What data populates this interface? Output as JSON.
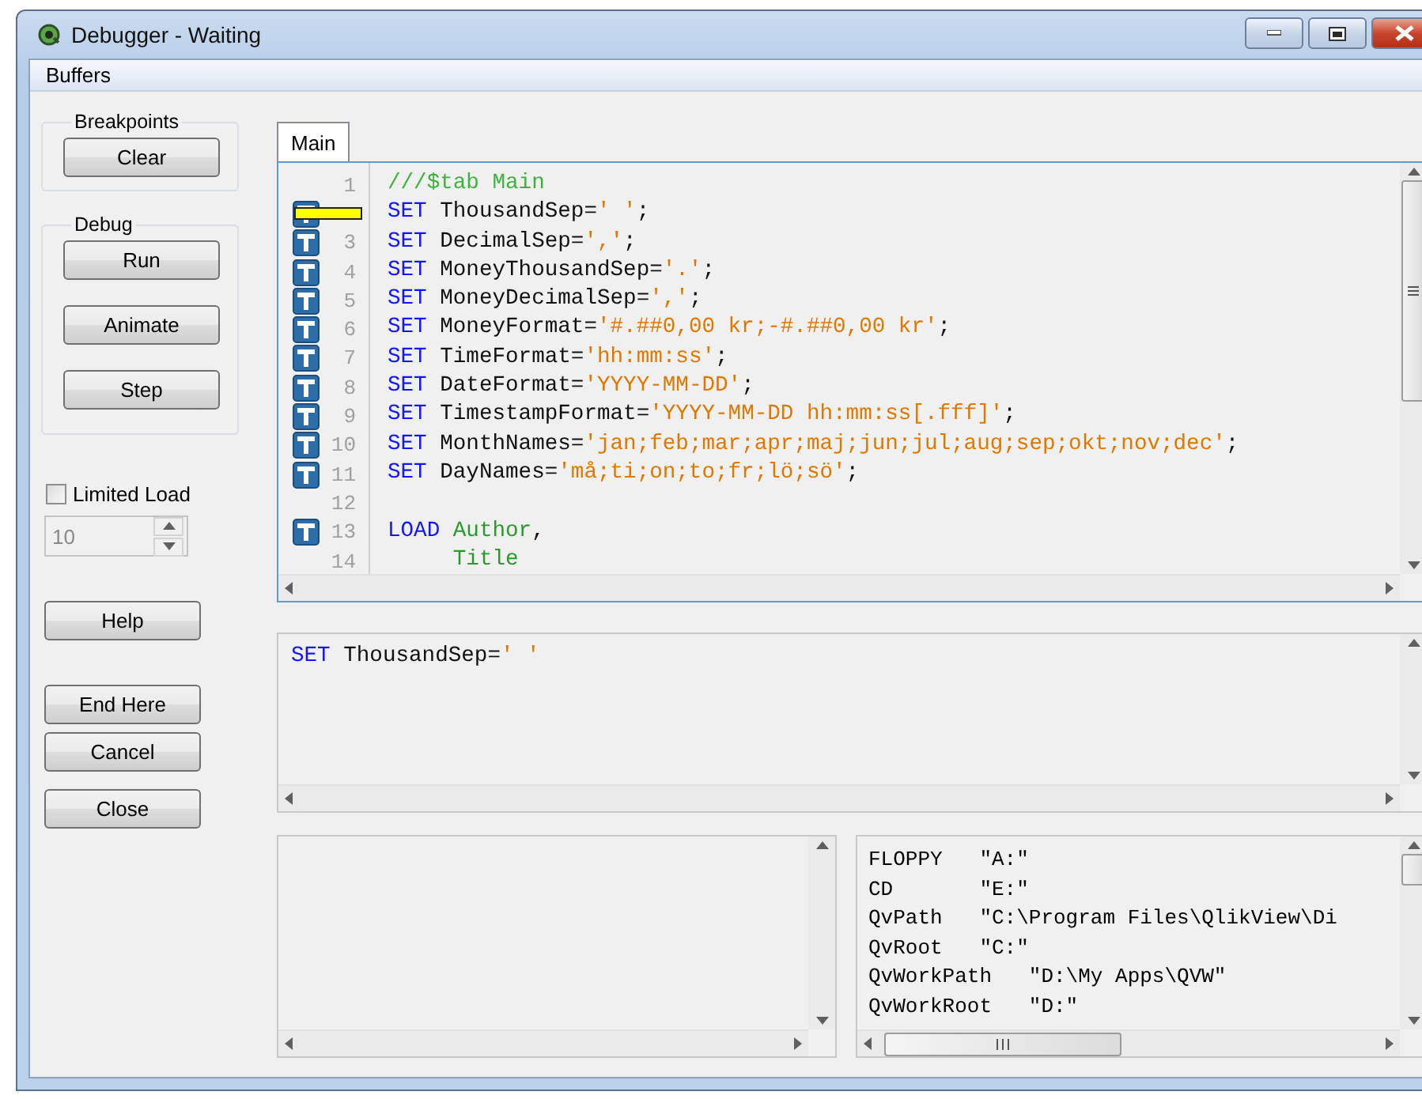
{
  "window": {
    "title": "Debugger - Waiting"
  },
  "menu": [
    {
      "label": "Buffers"
    }
  ],
  "breakpoints": {
    "title": "Breakpoints",
    "buttons": [
      "Clear"
    ]
  },
  "debug": {
    "title": "Debug",
    "buttons": [
      "Run",
      "Animate",
      "Step"
    ]
  },
  "limited_load": {
    "label": "Limited Load",
    "checked": false,
    "value": "10",
    "disabled": true
  },
  "side_buttons": [
    [
      "Help"
    ],
    [
      "End Here",
      "Cancel"
    ],
    [
      "Close"
    ]
  ],
  "tabs": [
    {
      "label": "Main",
      "selected": true
    }
  ],
  "editor": {
    "lines": [
      {
        "number": "1",
        "breakpoint": false,
        "current": false,
        "tokens": [
          {
            "kind": "comment",
            "text": "///$tab Main"
          }
        ]
      },
      {
        "breakpoint": true,
        "current": true,
        "tokens": [
          {
            "kind": "keyword",
            "text": "SET"
          },
          {
            "kind": "plain",
            "text": " ThousandSep="
          },
          {
            "kind": "string",
            "text": "' '"
          },
          {
            "kind": "plain",
            "text": ";"
          }
        ]
      },
      {
        "number": "3",
        "breakpoint": true,
        "current": false,
        "tokens": [
          {
            "kind": "keyword",
            "text": "SET"
          },
          {
            "kind": "plain",
            "text": " DecimalSep="
          },
          {
            "kind": "string",
            "text": "','"
          },
          {
            "kind": "plain",
            "text": ";"
          }
        ]
      },
      {
        "number": "4",
        "breakpoint": true,
        "current": false,
        "tokens": [
          {
            "kind": "keyword",
            "text": "SET"
          },
          {
            "kind": "plain",
            "text": " MoneyThousandSep="
          },
          {
            "kind": "string",
            "text": "'.'"
          },
          {
            "kind": "plain",
            "text": ";"
          }
        ]
      },
      {
        "number": "5",
        "breakpoint": true,
        "current": false,
        "tokens": [
          {
            "kind": "keyword",
            "text": "SET"
          },
          {
            "kind": "plain",
            "text": " MoneyDecimalSep="
          },
          {
            "kind": "string",
            "text": "','"
          },
          {
            "kind": "plain",
            "text": ";"
          }
        ]
      },
      {
        "number": "6",
        "breakpoint": true,
        "current": false,
        "tokens": [
          {
            "kind": "keyword",
            "text": "SET"
          },
          {
            "kind": "plain",
            "text": " MoneyFormat="
          },
          {
            "kind": "string",
            "text": "'#.##0,00 kr;-#.##0,00 kr'"
          },
          {
            "kind": "plain",
            "text": ";"
          }
        ]
      },
      {
        "number": "7",
        "breakpoint": true,
        "current": false,
        "tokens": [
          {
            "kind": "keyword",
            "text": "SET"
          },
          {
            "kind": "plain",
            "text": " TimeFormat="
          },
          {
            "kind": "string",
            "text": "'hh:mm:ss'"
          },
          {
            "kind": "plain",
            "text": ";"
          }
        ]
      },
      {
        "number": "8",
        "breakpoint": true,
        "current": false,
        "tokens": [
          {
            "kind": "keyword",
            "text": "SET"
          },
          {
            "kind": "plain",
            "text": " DateFormat="
          },
          {
            "kind": "string",
            "text": "'YYYY-MM-DD'"
          },
          {
            "kind": "plain",
            "text": ";"
          }
        ]
      },
      {
        "number": "9",
        "breakpoint": true,
        "current": false,
        "tokens": [
          {
            "kind": "keyword",
            "text": "SET"
          },
          {
            "kind": "plain",
            "text": " TimestampFormat="
          },
          {
            "kind": "string",
            "text": "'YYYY-MM-DD hh:mm:ss[.fff]'"
          },
          {
            "kind": "plain",
            "text": ";"
          }
        ]
      },
      {
        "number": "10",
        "breakpoint": true,
        "current": false,
        "tokens": [
          {
            "kind": "keyword",
            "text": "SET"
          },
          {
            "kind": "plain",
            "text": " MonthNames="
          },
          {
            "kind": "string",
            "text": "'jan;feb;mar;apr;maj;jun;jul;aug;sep;okt;nov;dec'"
          },
          {
            "kind": "plain",
            "text": ";"
          }
        ]
      },
      {
        "number": "11",
        "breakpoint": true,
        "current": false,
        "tokens": [
          {
            "kind": "keyword",
            "text": "SET"
          },
          {
            "kind": "plain",
            "text": " DayNames="
          },
          {
            "kind": "string",
            "text": "'må;ti;on;to;fr;lö;sö'"
          },
          {
            "kind": "plain",
            "text": ";"
          }
        ]
      },
      {
        "number": "12",
        "breakpoint": false,
        "current": false
      },
      {
        "number": "13",
        "breakpoint": true,
        "current": false,
        "tokens": [
          {
            "kind": "keyword",
            "text": "LOAD"
          },
          {
            "kind": "field",
            "text": "Author",
            "spaced": true
          },
          {
            "kind": "plain",
            "text": ","
          }
        ]
      },
      {
        "number": "14",
        "breakpoint": false,
        "current": false,
        "indented": true,
        "tokens": [
          {
            "kind": "field",
            "text": "Title"
          }
        ]
      }
    ]
  },
  "current_statement": {
    "tokens": [
      {
        "kind": "keyword",
        "text": "SET"
      },
      {
        "kind": "plain",
        "text": " ThousandSep="
      },
      {
        "kind": "string",
        "text": "' '"
      }
    ]
  },
  "variables": [
    {
      "name": "FLOPPY",
      "value": "\"A:\""
    },
    {
      "name": "CD",
      "value": "\"E:\""
    },
    {
      "name": "QvPath",
      "value": "\"C:\\Program Files\\QlikView\\Di"
    },
    {
      "name": "QvRoot",
      "value": "\"C:\""
    },
    {
      "name": "QvWorkPath",
      "value": "\"D:\\My Apps\\QVW\""
    },
    {
      "name": "QvWorkRoot",
      "value": "\"D:\""
    }
  ]
}
